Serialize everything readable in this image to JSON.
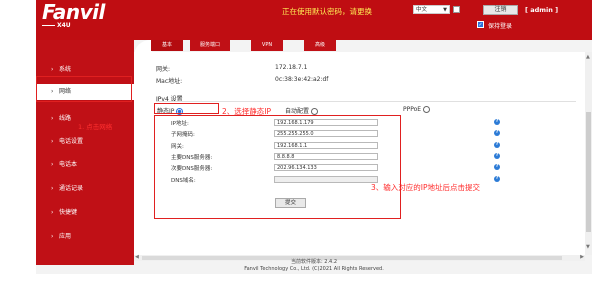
{
  "header": {
    "brand": "Fanvil",
    "model": "X4U",
    "warning": "正在使用默认密码，请更换",
    "language": "中文",
    "logout_label": "注销",
    "user": "[ admin ]",
    "keep_login_label": "保持登录"
  },
  "tabs": [
    {
      "label": "基本"
    },
    {
      "label": "服务端口"
    },
    {
      "label": "VPN"
    },
    {
      "label": "高级"
    }
  ],
  "sidebar": {
    "items": [
      {
        "label": "系统"
      },
      {
        "label": "网络"
      },
      {
        "label": "线路"
      },
      {
        "label": "电话设置"
      },
      {
        "label": "电话本"
      },
      {
        "label": "通话记录"
      },
      {
        "label": "快捷键"
      },
      {
        "label": "应用"
      }
    ],
    "annotation": "1. 点击网络"
  },
  "info": {
    "gateway_label": "网关:",
    "gateway_value": "172.18.7.1",
    "mac_label": "Mac地址:",
    "mac_value": "0c:38:3e:42:a2:df"
  },
  "ipv4": {
    "title": "IPv4 设置",
    "static_label": "静态IP",
    "dhcp_label": "自动配置",
    "pppoe_label": "PPPoE",
    "step2": "2、选择静态IP",
    "step3": "3、输入对应的IP地址后点击提交",
    "fields": [
      {
        "label": "IP地址:",
        "value": "192.168.1.179"
      },
      {
        "label": "子网掩码:",
        "value": "255.255.255.0"
      },
      {
        "label": "网关:",
        "value": "192.168.1.1"
      },
      {
        "label": "主要DNS服务器:",
        "value": "8.8.8.8"
      },
      {
        "label": "次要DNS服务器:",
        "value": "202.96.134.133"
      },
      {
        "label": "DNS域名:",
        "value": ""
      }
    ],
    "submit_label": "提交"
  },
  "footer": {
    "version": "当前软件版本: 2.4.2",
    "copyright": "Fanvil Technology Co., Ltd. (C)2021 All Rights Reserved."
  }
}
